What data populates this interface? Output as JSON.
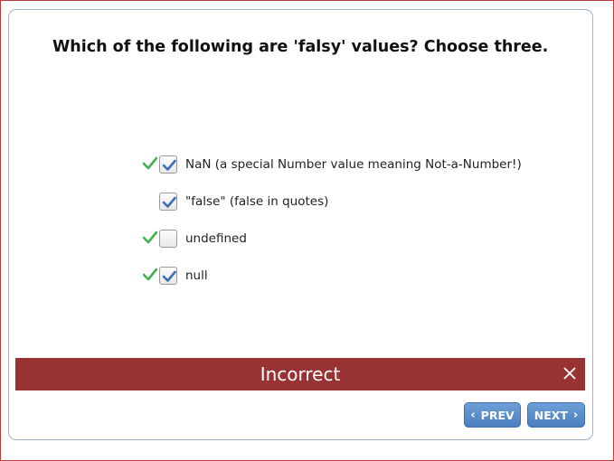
{
  "question": "Which of the following are 'falsy' values? Choose three.",
  "options": [
    {
      "label": "NaN (a special Number value meaning Not-a-Number!)",
      "checked": true,
      "correct_answer": true
    },
    {
      "label": "\"false\" (false in quotes)",
      "checked": true,
      "correct_answer": false
    },
    {
      "label": "undefined",
      "checked": false,
      "correct_answer": true
    },
    {
      "label": "null",
      "checked": true,
      "correct_answer": true
    }
  ],
  "feedback": {
    "text": "Incorrect",
    "close_icon": "close-icon",
    "color": "#993333"
  },
  "nav": {
    "prev_label": "PREV",
    "next_label": "NEXT",
    "prev_icon": "chevron-left-icon",
    "next_icon": "chevron-right-icon"
  },
  "colors": {
    "correct_mark": "#3fb34f",
    "checkbox_tick": "#3a6fb8",
    "button": "#5b8fcf",
    "card_border": "#9fb6cf"
  }
}
